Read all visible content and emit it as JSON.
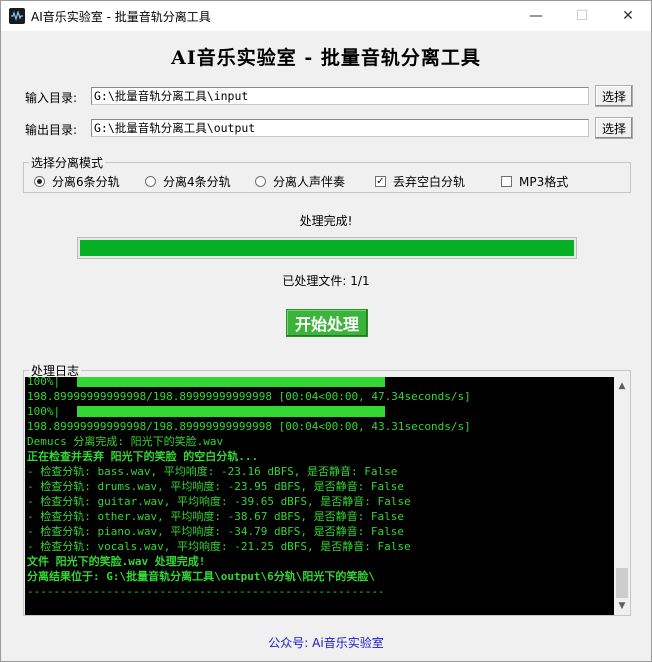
{
  "window": {
    "title": "AI音乐实验室 - 批量音轨分离工具",
    "minimize": "—",
    "maximize": "☐",
    "close": "✕"
  },
  "heading": "AI音乐实验室 - 批量音轨分离工具",
  "input": {
    "label": "输入目录:",
    "value": "G:\\批量音轨分离工具\\input",
    "button": "选择"
  },
  "output": {
    "label": "输出目录:",
    "value": "G:\\批量音轨分离工具\\output",
    "button": "选择"
  },
  "mode": {
    "legend": "选择分离模式",
    "options": [
      {
        "label": "分离6条分轨",
        "selected": true
      },
      {
        "label": "分离4条分轨",
        "selected": false
      },
      {
        "label": "分离人声伴奏",
        "selected": false
      }
    ],
    "checkboxes": [
      {
        "label": "丢弃空白分轨",
        "checked": true
      },
      {
        "label": "MP3格式",
        "checked": false
      }
    ]
  },
  "status": "处理完成!",
  "progress": {
    "fraction": 1.0,
    "color": "#06b025"
  },
  "count": "已处理文件: 1/1",
  "start_button": "开始处理",
  "log": {
    "legend": "处理日志",
    "lines": [
      {
        "text": "100%|",
        "bar": true,
        "bold": false
      },
      {
        "text": "198.89999999999998/198.89999999999998 [00:04<00:00, 47.34seconds/s]",
        "bar": false,
        "bold": false
      },
      {
        "text": "100%|",
        "bar": true,
        "bold": false
      },
      {
        "text": "198.89999999999998/198.89999999999998 [00:04<00:00, 43.31seconds/s]",
        "bar": false,
        "bold": false
      },
      {
        "text": "Demucs 分离完成: 阳光下的笑脸.wav",
        "bar": false,
        "bold": false
      },
      {
        "text": "正在检查并丢弃 阳光下的笑脸 的空白分轨...",
        "bar": false,
        "bold": true
      },
      {
        "text": "  - 检查分轨: bass.wav, 平均响度: -23.16 dBFS, 是否静音: False",
        "bar": false,
        "bold": false
      },
      {
        "text": "  - 检查分轨: drums.wav, 平均响度: -23.95 dBFS, 是否静音: False",
        "bar": false,
        "bold": false
      },
      {
        "text": "  - 检查分轨: guitar.wav, 平均响度: -39.65 dBFS, 是否静音: False",
        "bar": false,
        "bold": false
      },
      {
        "text": "  - 检查分轨: other.wav, 平均响度: -38.67 dBFS, 是否静音: False",
        "bar": false,
        "bold": false
      },
      {
        "text": "  - 检查分轨: piano.wav, 平均响度: -34.79 dBFS, 是否静音: False",
        "bar": false,
        "bold": false
      },
      {
        "text": "  - 检查分轨: vocals.wav, 平均响度: -21.25 dBFS, 是否静音: False",
        "bar": false,
        "bold": false
      },
      {
        "text": "文件 阳光下的笑脸.wav 处理完成!",
        "bar": false,
        "bold": true
      },
      {
        "text": "分离结果位于: G:\\批量音轨分离工具\\output\\6分轨\\阳光下的笑脸\\",
        "bar": false,
        "bold": true
      },
      {
        "text": "------------------------------------------------------",
        "bar": false,
        "bold": false
      }
    ],
    "text_color": "#33d633",
    "background": "#000000"
  },
  "footer": "公众号: Ai音乐实验室",
  "colors": {
    "footer_text": "#1a1acc",
    "start_button": "#3cb33c"
  }
}
